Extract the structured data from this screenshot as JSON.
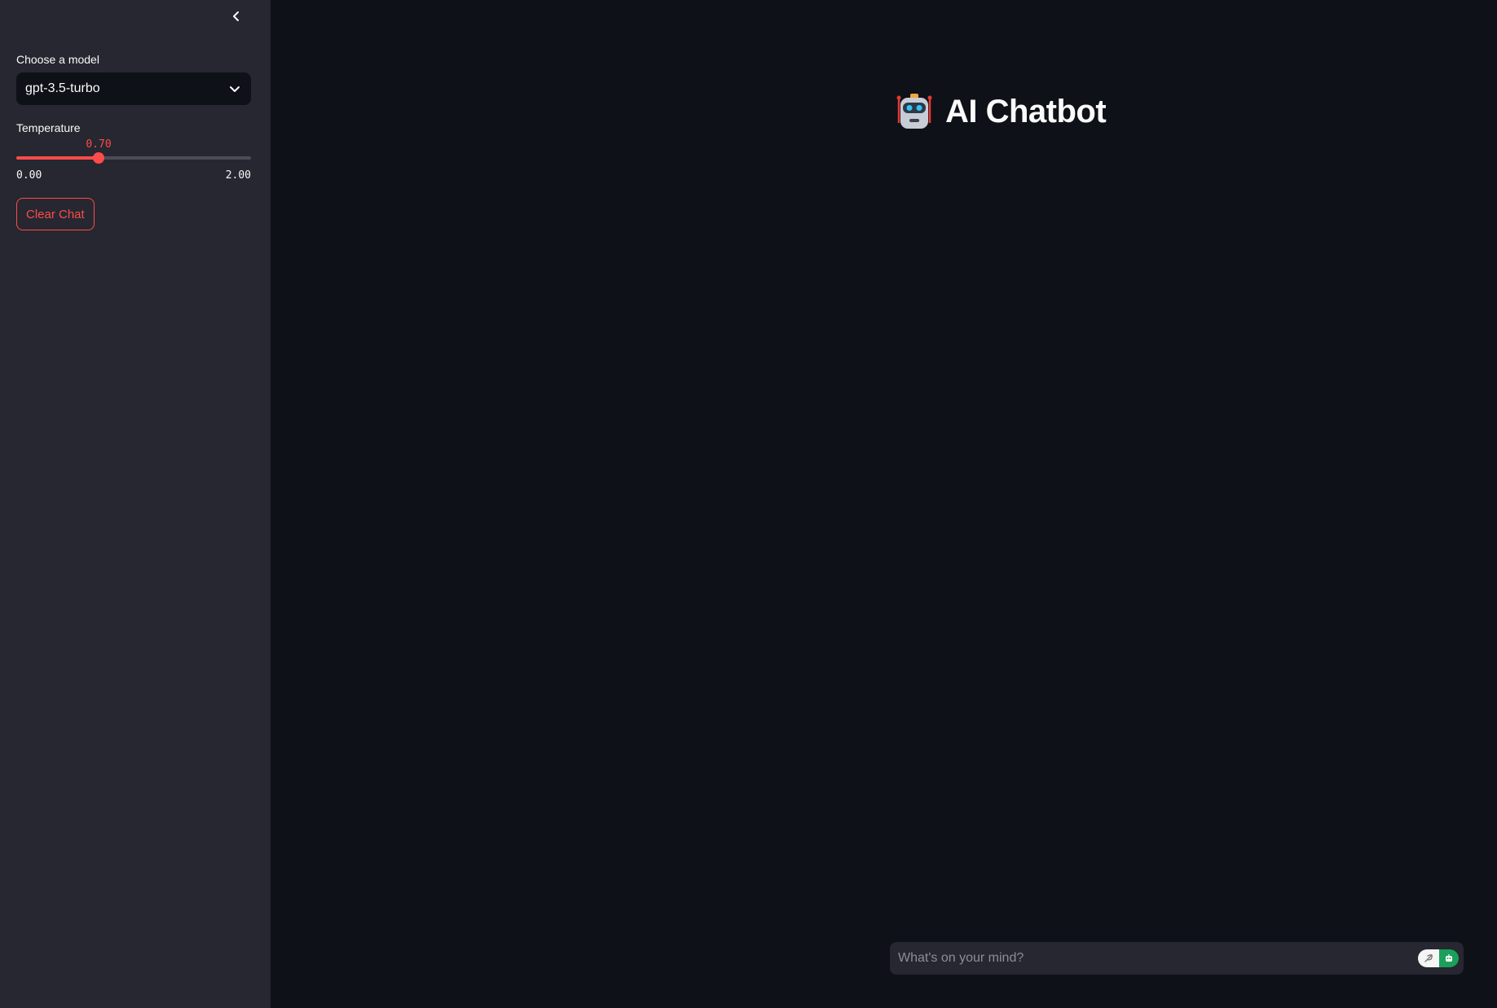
{
  "sidebar": {
    "collapse_icon": "chevron-left-icon",
    "model_label": "Choose a model",
    "model_selected": "gpt-3.5-turbo",
    "temperature_label": "Temperature",
    "temperature_value": "0.70",
    "temperature_min": "0.00",
    "temperature_max": "2.00",
    "temperature_fraction": 0.35,
    "clear_button": "Clear Chat"
  },
  "main": {
    "title_icon": "robot-icon",
    "title": "AI Chatbot",
    "chat_placeholder": "What's on your mind?"
  },
  "colors": {
    "accent": "#ff4b4b",
    "background": "#0e1117",
    "sidebar": "#262730"
  }
}
